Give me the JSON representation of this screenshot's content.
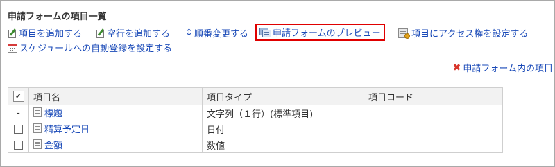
{
  "page": {
    "title": "申請フォームの項目一覧"
  },
  "actions": {
    "add_item": "項目を追加する",
    "add_blank_row": "空行を追加する",
    "reorder": "順番変更する",
    "preview": "申請フォームのプレビュー",
    "access": "項目にアクセス権を設定する",
    "schedule": "スケジュールへの自動登録を設定する"
  },
  "delete_link": "申請フォーム内の項目",
  "table": {
    "headers": [
      "項目名",
      "項目タイプ",
      "項目コード"
    ],
    "rows": [
      {
        "select": "-",
        "name": "標題",
        "type": "文字列（１行）(標準項目)",
        "code": ""
      },
      {
        "select": "checkbox",
        "name": "精算予定日",
        "type": "日付",
        "code": ""
      },
      {
        "select": "checkbox",
        "name": "金額",
        "type": "数値",
        "code": ""
      }
    ]
  },
  "colors": {
    "link": "#1a4ab8",
    "highlight_border": "#e00000",
    "delete_icon": "#d8352a",
    "header_bg": "#f2f2f2"
  },
  "icons": [
    "edit-icon",
    "sort-arrows-icon",
    "preview-icon",
    "access-icon",
    "calendar-icon",
    "delete-x-icon",
    "item-icon",
    "checkbox"
  ]
}
